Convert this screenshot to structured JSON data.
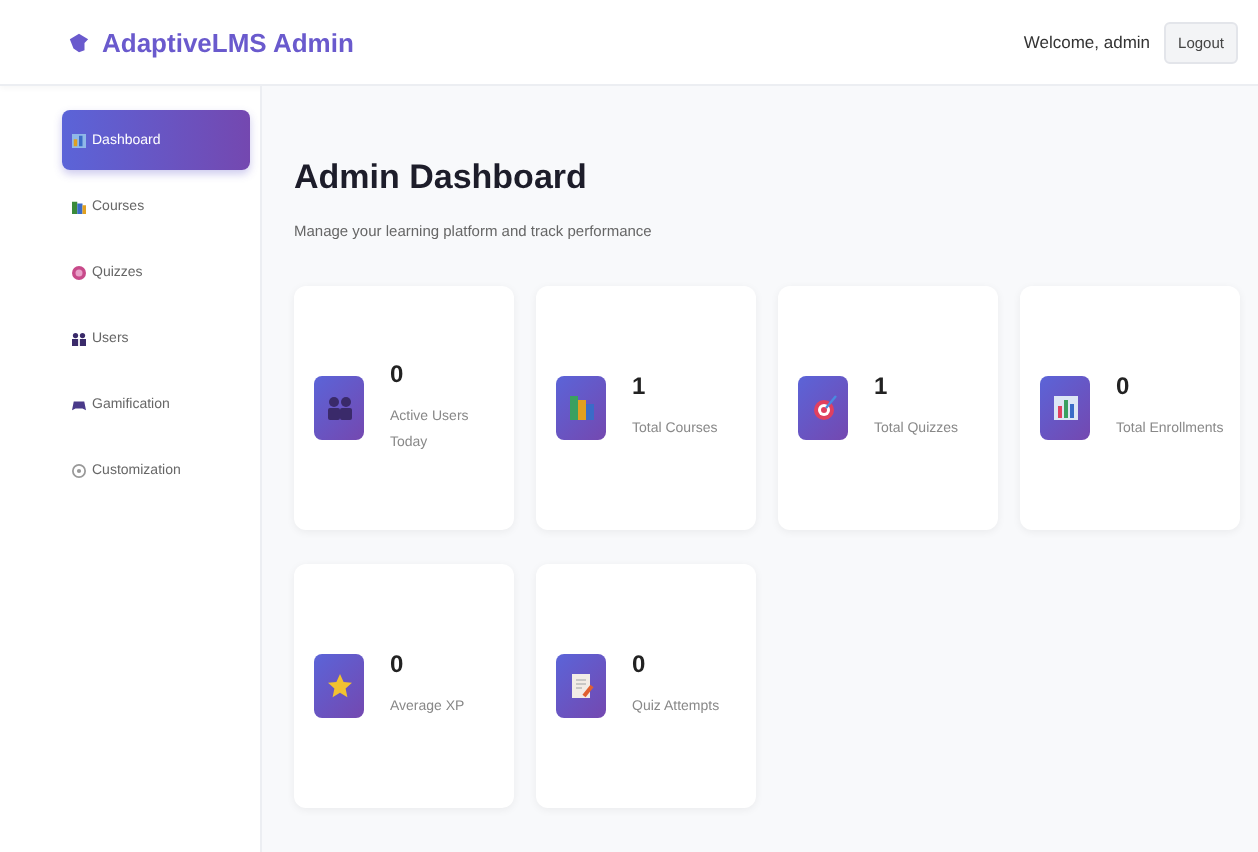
{
  "header": {
    "brand": "AdaptiveLMS Admin",
    "welcome": "Welcome, admin",
    "logout": "Logout"
  },
  "sidebar": {
    "items": [
      {
        "label": "Dashboard",
        "kind": "dashboard",
        "selected": true
      },
      {
        "label": "Courses",
        "kind": "courses",
        "selected": false
      },
      {
        "label": "Quizzes",
        "kind": "quizzes",
        "selected": false
      },
      {
        "label": "Users",
        "kind": "users",
        "selected": false
      },
      {
        "label": "Gamification",
        "kind": "gamification",
        "selected": false
      },
      {
        "label": "Customization",
        "kind": "customization",
        "selected": false
      }
    ]
  },
  "main": {
    "title": "Admin Dashboard",
    "subtitle": "Manage your learning platform and track performance",
    "stats": [
      {
        "value": "0",
        "label": "Active Users Today",
        "kind": "users"
      },
      {
        "value": "1",
        "label": "Total Courses",
        "kind": "courses"
      },
      {
        "value": "1",
        "label": "Total Quizzes",
        "kind": "quizzes"
      },
      {
        "value": "0",
        "label": "Total Enrollments",
        "kind": "enrollments"
      },
      {
        "value": "0",
        "label": "Average XP",
        "kind": "xp"
      },
      {
        "value": "0",
        "label": "Quiz Attempts",
        "kind": "attempts"
      }
    ]
  }
}
